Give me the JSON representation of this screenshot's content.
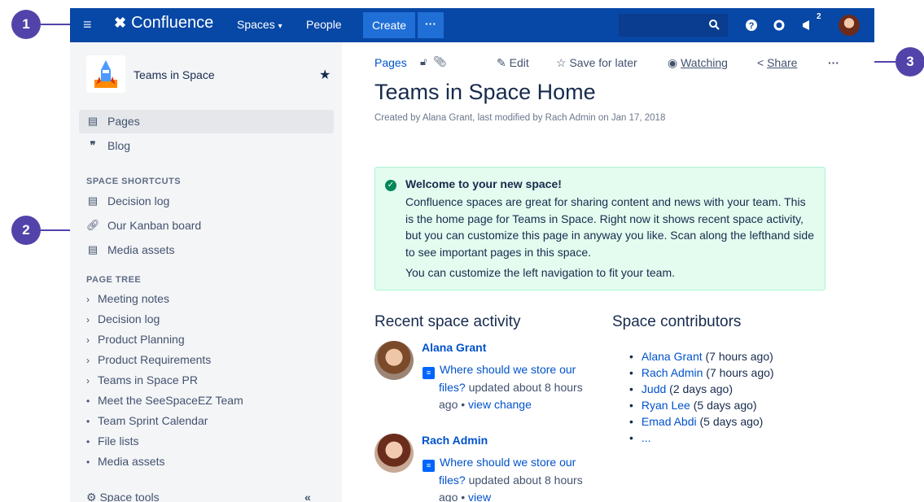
{
  "header": {
    "product": "Confluence",
    "spaces_label": "Spaces",
    "people_label": "People",
    "create_label": "Create",
    "more_label": "···",
    "notif_count": "2"
  },
  "sidebar": {
    "space_name": "Teams in Space",
    "nav": [
      {
        "label": "Pages",
        "icon": "page-icon"
      },
      {
        "label": "Blog",
        "icon": "quote-icon"
      }
    ],
    "shortcuts_heading": "SPACE SHORTCUTS",
    "shortcuts": [
      {
        "label": "Decision log",
        "icon": "page-icon"
      },
      {
        "label": "Our Kanban board",
        "icon": "link-icon"
      },
      {
        "label": "Media assets",
        "icon": "page-icon"
      }
    ],
    "tree_heading": "PAGE TREE",
    "tree": [
      {
        "label": "Meeting notes",
        "marker": "›"
      },
      {
        "label": "Decision log",
        "marker": "›"
      },
      {
        "label": "Product Planning",
        "marker": "›"
      },
      {
        "label": "Product Requirements",
        "marker": "›"
      },
      {
        "label": "Teams in Space PR",
        "marker": "›"
      },
      {
        "label": "Meet the SeeSpaceEZ Team",
        "marker": "•"
      },
      {
        "label": "Team Sprint Calendar",
        "marker": "•"
      },
      {
        "label": "File lists",
        "marker": "•"
      },
      {
        "label": "Media assets",
        "marker": "•"
      }
    ],
    "tools_label": "Space tools",
    "collapse_label": "«"
  },
  "page": {
    "breadcrumb": "Pages",
    "actions": {
      "edit": "Edit",
      "save": "Save for later",
      "watch": "Watching",
      "share": "Share",
      "more": "···"
    },
    "title": "Teams in Space Home",
    "meta": "Created by Alana Grant, last modified by Rach Admin on Jan 17, 2018",
    "panel": {
      "title": "Welcome to your new space!",
      "body": "Confluence spaces are great for sharing content and news with your team. This is the home page for Teams in Space. Right now it shows recent space activity, but you can customize this page in anyway you like. Scan along the lefthand side to see important pages in this space.",
      "footer": "You can customize the left navigation to fit your team."
    },
    "activity": {
      "heading": "Recent space activity",
      "items": [
        {
          "user": "Alana Grant",
          "page": "Where should we store our files?",
          "updated": " updated about 8 hours ago • ",
          "view": "view change"
        },
        {
          "user": "Rach Admin",
          "page": "Where should we store our files?",
          "updated": " updated about 8 hours ago • ",
          "view": "view"
        }
      ]
    },
    "contributors": {
      "heading": "Space contributors",
      "items": [
        {
          "name": "Alana Grant",
          "when": " (7 hours ago)"
        },
        {
          "name": "Rach Admin",
          "when": " (7 hours ago)"
        },
        {
          "name": "Judd",
          "when": " (2 days ago)"
        },
        {
          "name": "Ryan Lee",
          "when": " (5 days ago)"
        },
        {
          "name": "Emad Abdi",
          "when": " (5 days ago)"
        },
        {
          "name": "...",
          "when": ""
        }
      ]
    }
  },
  "callouts": [
    "1",
    "2",
    "3"
  ],
  "colors": {
    "header_bg": "#0747a6",
    "accent": "#0052cc",
    "callout": "#5243aa",
    "success": "#00875a"
  }
}
